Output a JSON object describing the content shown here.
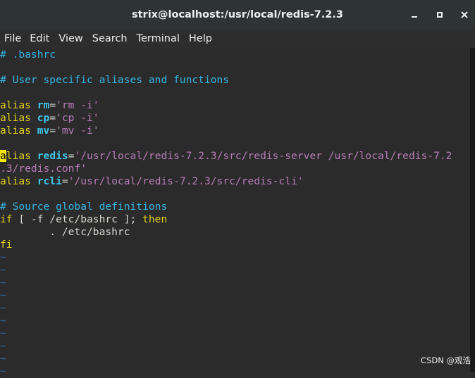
{
  "window": {
    "title": "strix@localhost:/usr/local/redis-7.2.3",
    "minimize_icon": "minimize-icon",
    "maximize_icon": "maximize-icon",
    "close_icon": "close-icon"
  },
  "menu": {
    "file": "File",
    "edit": "Edit",
    "view": "View",
    "search": "Search",
    "terminal": "Terminal",
    "help": "Help"
  },
  "editor": {
    "l1": "# .bashrc",
    "l3": "# User specific aliases and functions",
    "alias_kw": "alias",
    "rm_name": "rm",
    "rm_val": "'rm -i'",
    "cp_name": "cp",
    "cp_val": "'cp -i'",
    "mv_name": "mv",
    "mv_val": "'mv -i'",
    "cursor_char": "a",
    "alias_rest": "lias",
    "redis_name": "redis",
    "redis_val_1": "'/usr/local/redis-7.2.3/src/redis-server /usr/local/redis-7.2",
    "redis_val_2": ".3/redis.conf'",
    "rcli_name": "rcli",
    "rcli_val": "'/usr/local/redis-7.2.3/src/redis-cli'",
    "source_comment": "# Source global definitions",
    "if_kw": "if",
    "if_mid": " [ -f /etc/bashrc ]; ",
    "then_kw": "then",
    "dot_line": "        . /etc/bashrc",
    "fi_kw": "fi",
    "eq": "=",
    "tilde": "~"
  },
  "watermark": "CSDN @观浩"
}
